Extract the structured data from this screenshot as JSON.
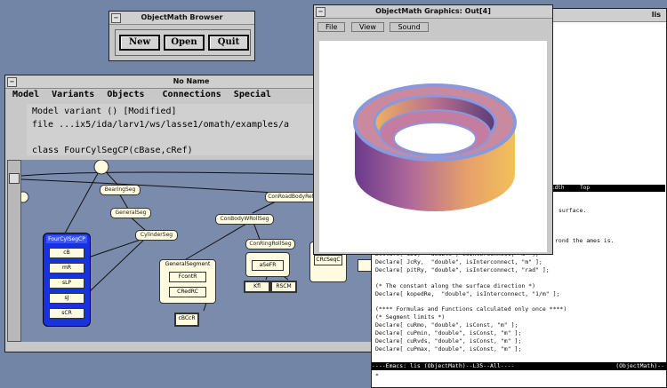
{
  "browser": {
    "title": "ObjectMath Browser",
    "buttons": [
      "New",
      "Open",
      "Quit"
    ]
  },
  "noname": {
    "title": "No Name",
    "menu": [
      "Model",
      "Variants",
      "Objects",
      "Connections",
      "Special"
    ],
    "lines": [
      "Model  variant () [Modified]",
      "file ...ix5/ida/larv1/ws/lasse1/omath/examples/a",
      "class FourCylSegCP(cBase,cRef)"
    ],
    "nodes": {
      "n1": "BearingSeg",
      "n2": "GeneralSeg",
      "n3": "CylinderSeg",
      "n4": "ConRoadBodyRef",
      "n5": "ConBodyWRollSeg",
      "n6": "ConRingRollSeg"
    },
    "selected": {
      "title": "FourCylSegCP",
      "items": [
        "cB",
        "mR",
        "sLP",
        "sJ",
        "sCR"
      ]
    },
    "box1": {
      "title": "GeneralSegment",
      "items": [
        "FcontR",
        "CRedRC"
      ]
    },
    "box2": {
      "items": [
        "aSeFR"
      ]
    },
    "mini": [
      "Kfl",
      "RSCM"
    ],
    "box3": {
      "items": [
        "CRcSeqC"
      ]
    },
    "leaf": "cBCcR"
  },
  "graphics": {
    "title": "ObjectMath Graphics: Out[4]",
    "menu": [
      "File",
      "View",
      "Sound"
    ]
  },
  "editor": {
    "title_tail": "lis",
    "highlight": [
      "ElecWidth",
      "Top"
    ],
    "lines_mid": [
      "surface.",
      "",
      "rond the ames is."
    ],
    "lines": [
      "Declare[ sJ1,  \"double\", isInterconnect, \"m\" ];",
      "Declare[ JcRy,  \"double\", isInterconnect, \"m\" ];",
      "Declare[ pitRy, \"double\", isInterconnect, \"rad\" ];",
      "",
      "(* The constant along the surface direction *)",
      "Declare[ kopedRe,  \"double\", isInterconnect, \"1/m\" ];",
      "",
      "(**** Formulas and Functions calculated only once ****)",
      "(* Segment limits *)",
      "Declare[ cuRmo, \"double\", isConst, \"m\" ];",
      "Declare[ cuPmin, \"double\", isConst, \"m\" ];",
      "Declare[ cuRvds, \"double\", isConst, \"m\" ];",
      "Declare[ cuPmax, \"double\", isConst, \"m\" ];"
    ],
    "status": "----Emacs: lis  (ObjectMath)--L35--All----",
    "status_right": "(ObjectMath)--",
    "prompt": "*"
  }
}
